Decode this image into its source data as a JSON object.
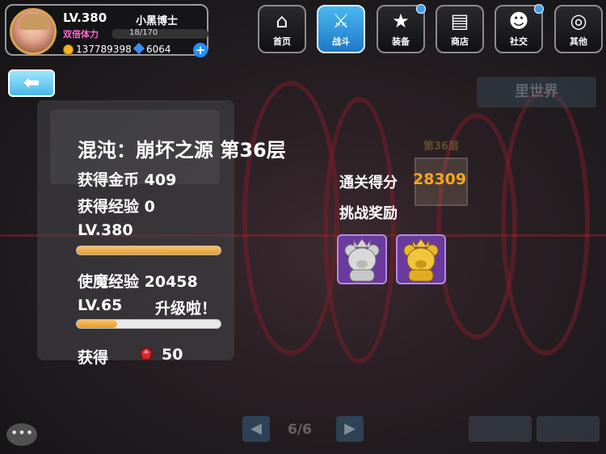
{
  "player": {
    "level": "LV.380",
    "name": "小黑博士",
    "stamina_label": "双倍体力",
    "stamina_value": "18/170",
    "stamina_fraction": 0.106,
    "coins": "137789398",
    "gems": "6064",
    "add_label": "+"
  },
  "nav": [
    {
      "label": "首页",
      "icon": "home-icon",
      "active": false,
      "dot": false
    },
    {
      "label": "战斗",
      "icon": "battle-icon",
      "active": true,
      "dot": false
    },
    {
      "label": "装备",
      "icon": "equipment-icon",
      "active": false,
      "dot": true
    },
    {
      "label": "商店",
      "icon": "shop-icon",
      "active": false,
      "dot": false
    },
    {
      "label": "社交",
      "icon": "social-icon",
      "active": false,
      "dot": true
    },
    {
      "label": "其他",
      "icon": "other-icon",
      "active": false,
      "dot": false
    }
  ],
  "back_icon": "arrow-left-icon",
  "background_label": "里世界",
  "background_card_label": "第36层",
  "result": {
    "title": "混沌：崩坏之源 第36层",
    "gold_label": "获得金币",
    "gold_value": "409",
    "exp_label": "获得经验",
    "exp_value": "0",
    "player_level": "LV.380",
    "player_level_fraction": 1.0,
    "pet_exp_label": "使魔经验",
    "pet_exp_value": "20458",
    "pet_level": "LV.65",
    "level_up_text": "升级啦！",
    "pet_level_fraction": 0.28,
    "obtain_label": "获得",
    "obtain_value": "50",
    "obtain_icon": "red-gem-icon"
  },
  "clear": {
    "score_label": "通关得分",
    "score_value": "28309",
    "reward_label": "挑战奖励",
    "rewards": [
      {
        "icon": "silver-bear-icon",
        "color": "#c9c9c9"
      },
      {
        "icon": "gold-bear-icon",
        "color": "#e6b627"
      }
    ]
  },
  "pager": {
    "text": "6/6"
  },
  "colors": {
    "accent_blue": "#4bb8e8",
    "score_orange": "#f5a623",
    "stamina_pink": "#ff6ad0",
    "bar_orange": "#e49a2a"
  }
}
